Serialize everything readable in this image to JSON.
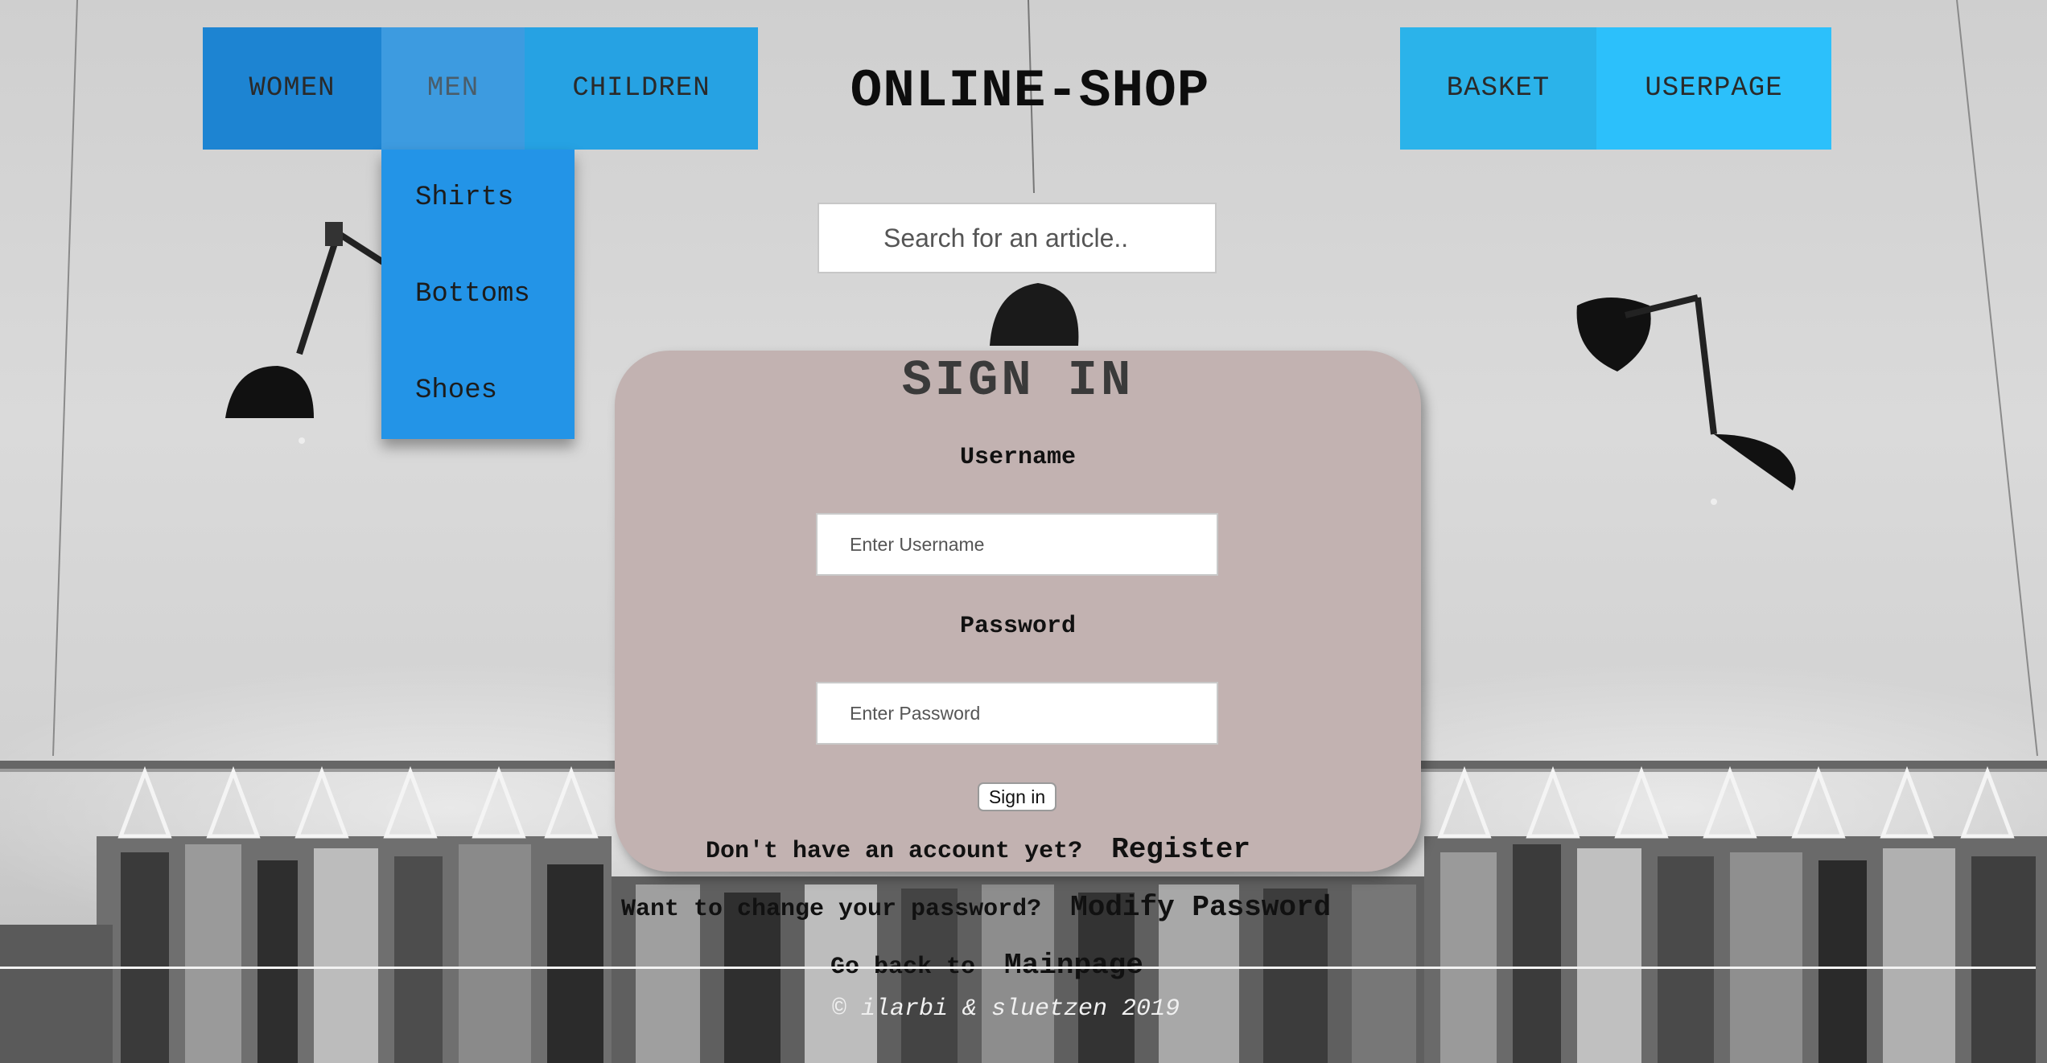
{
  "nav": {
    "women": "WOMEN",
    "men": "MEN",
    "children": "CHILDREN",
    "basket": "BASKET",
    "userpage": "USERPAGE",
    "men_dropdown": [
      "Shirts",
      "Bottoms",
      "Shoes"
    ]
  },
  "header": {
    "title": "ONLINE-SHOP"
  },
  "search": {
    "placeholder": "Search for an article.."
  },
  "signin": {
    "title": "SIGN IN",
    "username_label": "Username",
    "username_placeholder": "Enter Username",
    "password_label": "Password",
    "password_placeholder": "Enter Password",
    "button": "Sign in",
    "register_question": "Don't have an account yet?",
    "register_link": "Register",
    "modify_question": "Want to change your password?",
    "modify_link": "Modify Password",
    "mainpage_question": "Go back to",
    "mainpage_link": "Mainpage"
  },
  "footer": {
    "text": "© ilarbi & sluetzen 2019"
  },
  "colors": {
    "nav_women": "#1d84d2",
    "nav_men_active": "#3d9be0",
    "nav_children": "#26a2e3",
    "nav_basket": "#2bb3ea",
    "nav_userpage": "#2cc0fb",
    "dropdown": "#2394e7",
    "card": "#c2b2b1"
  }
}
